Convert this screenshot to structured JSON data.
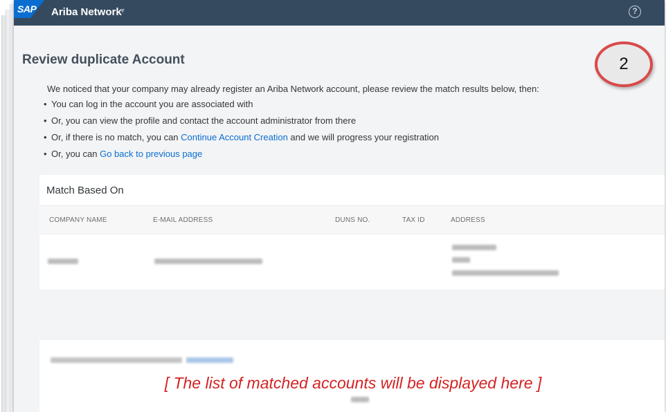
{
  "header": {
    "logo_text": "SAP",
    "app_name": "Ariba Network",
    "app_caret": "▾",
    "help_icon": "help-circle-icon",
    "help_glyph": "?"
  },
  "step_badge": "2",
  "page_title": "Review duplicate Account",
  "intro": "We noticed that your company may already register an Ariba Network account, please review the match results below, then:",
  "bullets": {
    "b1": "You can log in the account you are associated with",
    "b2": "Or, you can view the profile and contact the account administrator from there",
    "b3_before": "Or, if there is no match, you can ",
    "b3_link": "Continue Account Creation",
    "b3_after": " and we will progress your registration",
    "b4_before": "Or, you can ",
    "b4_link": "Go back to previous page"
  },
  "match_card": {
    "title": "Match Based On",
    "columns": [
      "COMPANY NAME",
      "E-MAIL ADDRESS",
      "DUNS NO.",
      "TAX ID",
      "ADDRESS"
    ]
  },
  "placeholder_note": "[ The list of matched accounts will be displayed here ]",
  "colors": {
    "header_bg": "#354a5f",
    "sap_blue": "#0a6ed1",
    "link": "#0a6ed1",
    "note_red": "#d42222",
    "badge_border": "#d94a4a"
  }
}
